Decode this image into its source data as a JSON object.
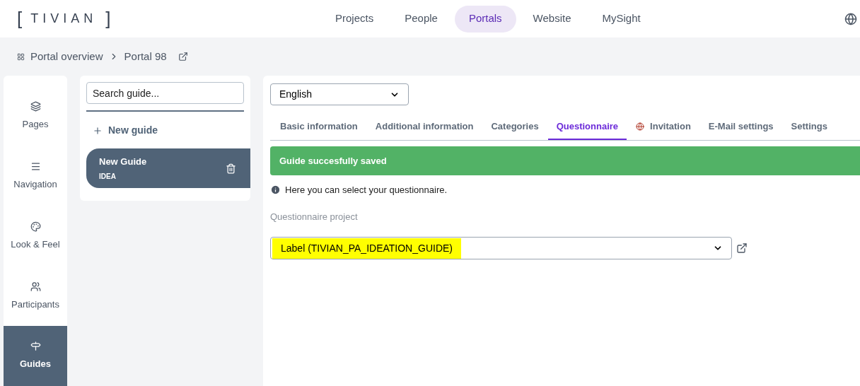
{
  "header": {
    "logo": "TIVIAN",
    "logo_brackets": [
      "[",
      "]"
    ],
    "nav": [
      {
        "label": "Projects",
        "selected": false
      },
      {
        "label": "People",
        "selected": false
      },
      {
        "label": "Portals",
        "selected": true
      },
      {
        "label": "Website",
        "selected": false
      },
      {
        "label": "MySight",
        "selected": false
      }
    ]
  },
  "breadcrumb": [
    "Portal overview",
    "Portal 98"
  ],
  "sidebar": {
    "items": [
      {
        "label": "Pages",
        "selected": false
      },
      {
        "label": "Navigation",
        "selected": false
      },
      {
        "label": "Look & Feel",
        "selected": false
      },
      {
        "label": "Participants",
        "selected": false
      },
      {
        "label": "Guides",
        "selected": true
      }
    ]
  },
  "guides": {
    "search": {
      "placeholder": "Search guide..."
    },
    "new_button": "New guide",
    "items": [
      {
        "title": "New Guide",
        "subtitle": "IDEA",
        "selected": true
      }
    ]
  },
  "main": {
    "language": "English",
    "tabs": [
      {
        "label": "Basic information",
        "selected": false,
        "globe": false
      },
      {
        "label": "Additional information",
        "selected": false,
        "globe": false
      },
      {
        "label": "Categories",
        "selected": false,
        "globe": false
      },
      {
        "label": "Questionnaire",
        "selected": true,
        "globe": false
      },
      {
        "label": "Invitation",
        "selected": false,
        "globe": true
      },
      {
        "label": "E-Mail settings",
        "selected": false,
        "globe": false
      },
      {
        "label": "Settings",
        "selected": false,
        "globe": false
      }
    ],
    "alert": "Guide succesfully saved",
    "info": "Here you can select your questionnaire.",
    "field_label": "Questionnaire project",
    "field_value": "Label (TIVIAN_PA_IDEATION_GUIDE)",
    "highlighted": true
  }
}
